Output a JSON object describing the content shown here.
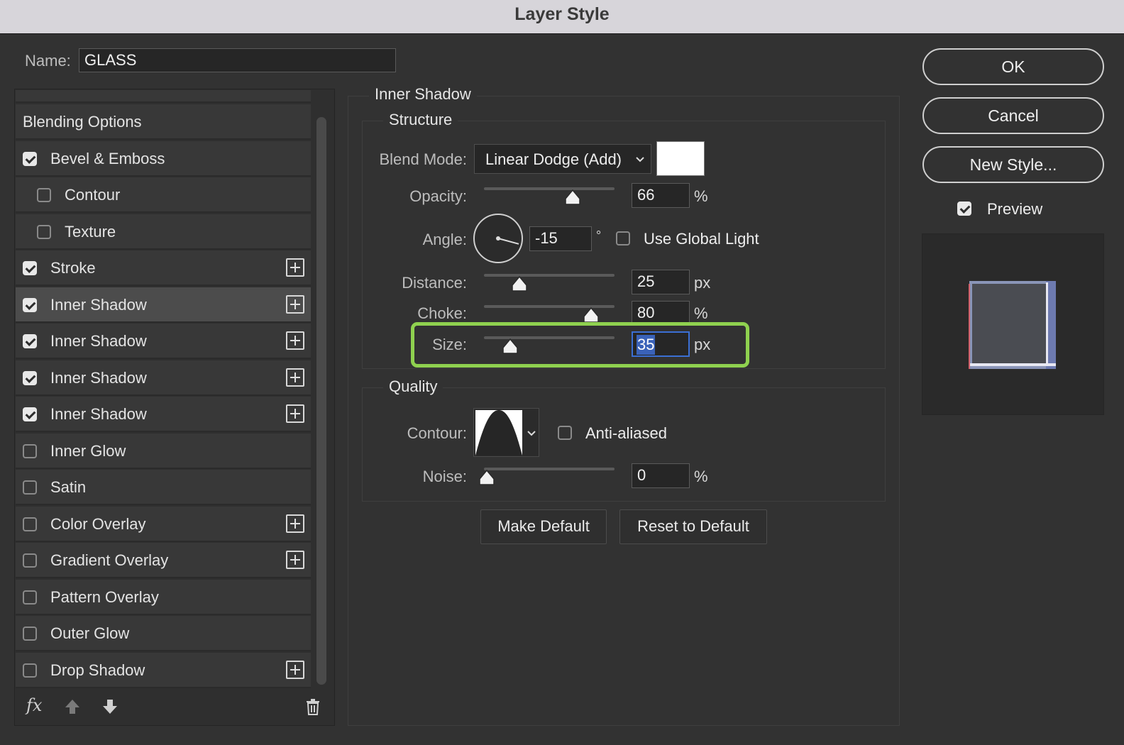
{
  "window": {
    "title": "Layer Style"
  },
  "name_field": {
    "label": "Name:",
    "value": "GLASS"
  },
  "styles_list": [
    {
      "label": "Blending Options",
      "checkbox": null,
      "plus": false,
      "selected": false
    },
    {
      "label": "Bevel & Emboss",
      "checkbox": true,
      "plus": false,
      "selected": false
    },
    {
      "label": "Contour",
      "checkbox": false,
      "plus": false,
      "selected": false,
      "indent": true
    },
    {
      "label": "Texture",
      "checkbox": false,
      "plus": false,
      "selected": false,
      "indent": true
    },
    {
      "label": "Stroke",
      "checkbox": true,
      "plus": true,
      "selected": false
    },
    {
      "label": "Inner Shadow",
      "checkbox": true,
      "plus": true,
      "selected": true
    },
    {
      "label": "Inner Shadow",
      "checkbox": true,
      "plus": true,
      "selected": false
    },
    {
      "label": "Inner Shadow",
      "checkbox": true,
      "plus": true,
      "selected": false
    },
    {
      "label": "Inner Shadow",
      "checkbox": true,
      "plus": true,
      "selected": false
    },
    {
      "label": "Inner Glow",
      "checkbox": false,
      "plus": false,
      "selected": false
    },
    {
      "label": "Satin",
      "checkbox": false,
      "plus": false,
      "selected": false
    },
    {
      "label": "Color Overlay",
      "checkbox": false,
      "plus": true,
      "selected": false
    },
    {
      "label": "Gradient Overlay",
      "checkbox": false,
      "plus": true,
      "selected": false
    },
    {
      "label": "Pattern Overlay",
      "checkbox": false,
      "plus": false,
      "selected": false
    },
    {
      "label": "Outer Glow",
      "checkbox": false,
      "plus": false,
      "selected": false
    },
    {
      "label": "Drop Shadow",
      "checkbox": false,
      "plus": true,
      "selected": false
    }
  ],
  "list_footer": {
    "fx_label": "fx",
    "icons": [
      "fx-icon",
      "move-up-icon",
      "move-down-icon",
      "trash-icon"
    ]
  },
  "panel": {
    "title": "Inner Shadow",
    "structure": {
      "legend": "Structure",
      "blend_mode": {
        "label": "Blend Mode:",
        "value": "Linear Dodge (Add)",
        "swatch_color": "#ffffff"
      },
      "opacity": {
        "label": "Opacity:",
        "value": "66",
        "unit": "%",
        "fraction": 0.66
      },
      "angle": {
        "label": "Angle:",
        "value": "-15",
        "unit": "°",
        "degrees": -15,
        "global_light_label": "Use Global Light",
        "global_light_checked": false
      },
      "distance": {
        "label": "Distance:",
        "value": "25",
        "unit": "px",
        "fraction": 0.25
      },
      "choke": {
        "label": "Choke:",
        "value": "80",
        "unit": "%",
        "fraction": 0.8
      },
      "size": {
        "label": "Size:",
        "value": "35",
        "unit": "px",
        "fraction": 0.18,
        "highlight_color": "#8fd14f"
      }
    },
    "quality": {
      "legend": "Quality",
      "contour": {
        "label": "Contour:",
        "anti_aliased_label": "Anti-aliased",
        "anti_aliased_checked": false
      },
      "noise": {
        "label": "Noise:",
        "value": "0",
        "unit": "%",
        "fraction": 0.0
      }
    },
    "make_default": "Make Default",
    "reset_default": "Reset to Default"
  },
  "actions": {
    "ok": "OK",
    "cancel": "Cancel",
    "new_style": "New Style...",
    "preview_label": "Preview",
    "preview_checked": true
  }
}
